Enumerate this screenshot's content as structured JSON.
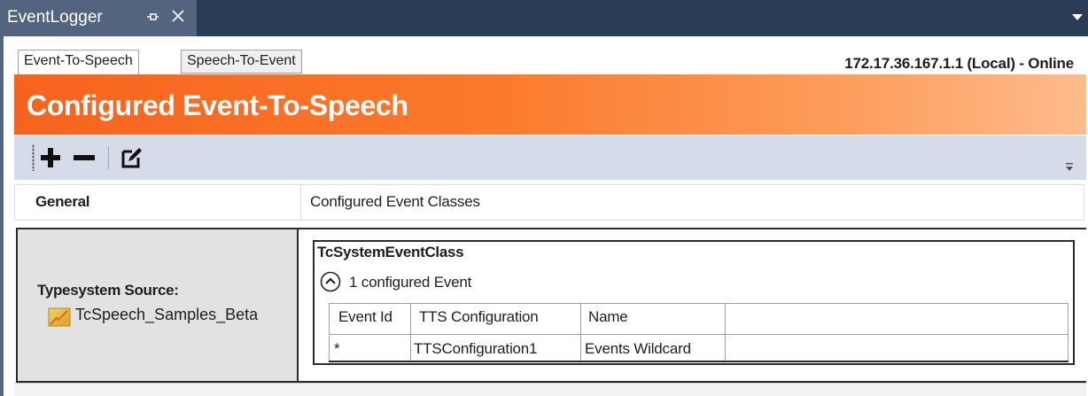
{
  "window": {
    "tab_title": "EventLogger",
    "icons": [
      "pin-icon",
      "close-icon",
      "overflow-chevron-icon"
    ]
  },
  "subtabs": {
    "active": "Event-To-Speech",
    "inactive": "Speech-To-Event"
  },
  "status": "172.17.36.167.1.1 (Local) - Online",
  "banner": {
    "title": "Configured Event-To-Speech"
  },
  "toolbar": {
    "icons": [
      "add-icon",
      "remove-icon",
      "edit-icon"
    ]
  },
  "grid": {
    "header": {
      "general": "General",
      "configured": "Configured Event Classes"
    },
    "typesystem": {
      "label": "Typesystem Source:",
      "value": "TcSpeech_Samples_Beta"
    },
    "event_class": {
      "name": "TcSystemEventClass",
      "count_text": "1 configured Event",
      "columns": [
        "Event Id",
        "TTS Configuration",
        "Name"
      ],
      "rows": [
        [
          "*",
          "TTSConfiguration1",
          "Events Wildcard"
        ]
      ]
    }
  },
  "colors": {
    "title_bar": "#2b3c56",
    "active_doc_tab": "#53647e",
    "banner_start": "#f6631e",
    "banner_end": "#fdbc8d",
    "toolbar": "#d6dbe9"
  }
}
